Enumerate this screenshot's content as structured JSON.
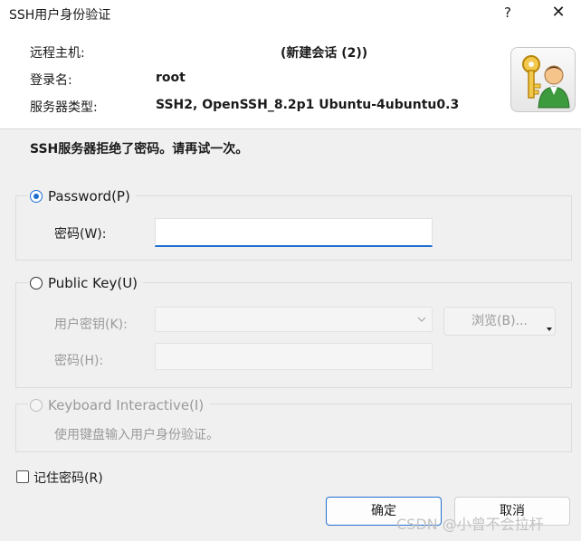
{
  "window": {
    "title": "SSH用户身份验证",
    "help_glyph": "?",
    "close_glyph": "✕"
  },
  "info": {
    "host_label": "远程主机:",
    "host_value": "(新建会话 (2))",
    "user_label": "登录名:",
    "user_value": "root",
    "server_label": "服务器类型:",
    "server_value": "SSH2, OpenSSH_8.2p1 Ubuntu-4ubuntu0.3",
    "avatar_icon": "user-key-icon"
  },
  "message": "SSH服务器拒绝了密码。请再试一次。",
  "password_group": {
    "radio_label": "Password(P)",
    "selected": true,
    "field_label": "密码(W):",
    "field_value": ""
  },
  "pubkey_group": {
    "radio_label": "Public Key(U)",
    "selected": false,
    "user_key_label": "用户密钥(K):",
    "user_key_value": "",
    "browse_label": "浏览(B)...",
    "passphrase_label": "密码(H):",
    "passphrase_value": ""
  },
  "keyboard_group": {
    "radio_label": "Keyboard Interactive(I)",
    "selected": false,
    "description": "使用键盘输入用户身份验证。"
  },
  "remember": {
    "label": "记住密码(R)",
    "checked": false
  },
  "buttons": {
    "ok": "确定",
    "cancel": "取消"
  },
  "watermark": "CSDN @小曾不会拉杆",
  "colors": {
    "accent": "#1f6fd1",
    "background": "#f0f0f0"
  }
}
